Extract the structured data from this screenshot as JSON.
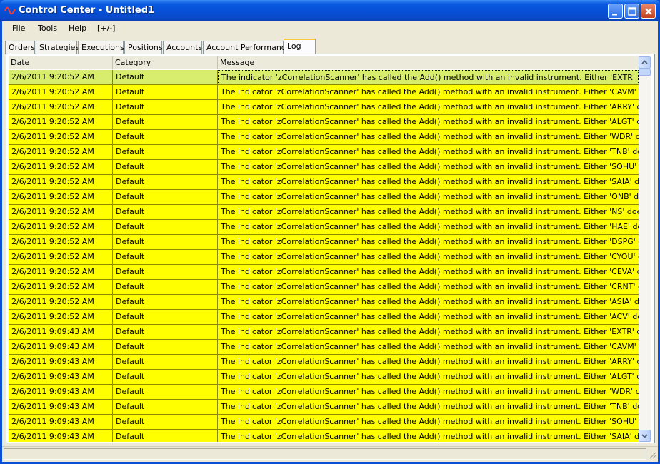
{
  "window": {
    "title": "Control Center - Untitled1"
  },
  "menu": {
    "items": [
      "File",
      "Tools",
      "Help",
      "[+/-]"
    ]
  },
  "tabs": [
    "Orders",
    "Strategies",
    "Executions",
    "Positions",
    "Accounts",
    "Account Performance",
    "Log"
  ],
  "active_tab": "Log",
  "grid": {
    "columns": [
      "Date",
      "Category",
      "Message"
    ],
    "rows": [
      {
        "date": "2/6/2011 9:20:52 AM",
        "category": "Default",
        "message": "The indicator 'zCorrelationScanner' has called the Add() method with an invalid instrument. Either 'EXTR' does not"
      },
      {
        "date": "2/6/2011 9:20:52 AM",
        "category": "Default",
        "message": "The indicator 'zCorrelationScanner' has called the Add() method with an invalid instrument. Either 'CAVM' does not"
      },
      {
        "date": "2/6/2011 9:20:52 AM",
        "category": "Default",
        "message": "The indicator 'zCorrelationScanner' has called the Add() method with an invalid instrument. Either 'ARRY' does not"
      },
      {
        "date": "2/6/2011 9:20:52 AM",
        "category": "Default",
        "message": "The indicator 'zCorrelationScanner' has called the Add() method with an invalid instrument. Either 'ALGT' does not e"
      },
      {
        "date": "2/6/2011 9:20:52 AM",
        "category": "Default",
        "message": "The indicator 'zCorrelationScanner' has called the Add() method with an invalid instrument. Either 'WDR' does not e"
      },
      {
        "date": "2/6/2011 9:20:52 AM",
        "category": "Default",
        "message": "The indicator 'zCorrelationScanner' has called the Add() method with an invalid instrument. Either 'TNB' does not ex"
      },
      {
        "date": "2/6/2011 9:20:52 AM",
        "category": "Default",
        "message": "The indicator 'zCorrelationScanner' has called the Add() method with an invalid instrument. Either 'SOHU' does not"
      },
      {
        "date": "2/6/2011 9:20:52 AM",
        "category": "Default",
        "message": "The indicator 'zCorrelationScanner' has called the Add() method with an invalid instrument. Either 'SAIA' does not e"
      },
      {
        "date": "2/6/2011 9:20:52 AM",
        "category": "Default",
        "message": "The indicator 'zCorrelationScanner' has called the Add() method with an invalid instrument. Either 'ONB' does not e"
      },
      {
        "date": "2/6/2011 9:20:52 AM",
        "category": "Default",
        "message": "The indicator 'zCorrelationScanner' has called the Add() method with an invalid instrument. Either 'NS' does not exis"
      },
      {
        "date": "2/6/2011 9:20:52 AM",
        "category": "Default",
        "message": "The indicator 'zCorrelationScanner' has called the Add() method with an invalid instrument. Either 'HAE' does not ex"
      },
      {
        "date": "2/6/2011 9:20:52 AM",
        "category": "Default",
        "message": "The indicator 'zCorrelationScanner' has called the Add() method with an invalid instrument. Either 'DSPG' does not"
      },
      {
        "date": "2/6/2011 9:20:52 AM",
        "category": "Default",
        "message": "The indicator 'zCorrelationScanner' has called the Add() method with an invalid instrument. Either 'CYOU' does not"
      },
      {
        "date": "2/6/2011 9:20:52 AM",
        "category": "Default",
        "message": "The indicator 'zCorrelationScanner' has called the Add() method with an invalid instrument. Either 'CEVA' does not"
      },
      {
        "date": "2/6/2011 9:20:52 AM",
        "category": "Default",
        "message": "The indicator 'zCorrelationScanner' has called the Add() method with an invalid instrument. Either 'CRNT' does not"
      },
      {
        "date": "2/6/2011 9:20:52 AM",
        "category": "Default",
        "message": "The indicator 'zCorrelationScanner' has called the Add() method with an invalid instrument. Either 'ASIA' does not e"
      },
      {
        "date": "2/6/2011 9:20:52 AM",
        "category": "Default",
        "message": "The indicator 'zCorrelationScanner' has called the Add() method with an invalid instrument. Either 'ACV' does not ex"
      },
      {
        "date": "2/6/2011 9:09:43 AM",
        "category": "Default",
        "message": "The indicator 'zCorrelationScanner' has called the Add() method with an invalid instrument. Either 'EXTR' does not"
      },
      {
        "date": "2/6/2011 9:09:43 AM",
        "category": "Default",
        "message": "The indicator 'zCorrelationScanner' has called the Add() method with an invalid instrument. Either 'CAVM' does not"
      },
      {
        "date": "2/6/2011 9:09:43 AM",
        "category": "Default",
        "message": "The indicator 'zCorrelationScanner' has called the Add() method with an invalid instrument. Either 'ARRY' does not"
      },
      {
        "date": "2/6/2011 9:09:43 AM",
        "category": "Default",
        "message": "The indicator 'zCorrelationScanner' has called the Add() method with an invalid instrument. Either 'ALGT' does not e"
      },
      {
        "date": "2/6/2011 9:09:43 AM",
        "category": "Default",
        "message": "The indicator 'zCorrelationScanner' has called the Add() method with an invalid instrument. Either 'WDR' does not e"
      },
      {
        "date": "2/6/2011 9:09:43 AM",
        "category": "Default",
        "message": "The indicator 'zCorrelationScanner' has called the Add() method with an invalid instrument. Either 'TNB' does not ex"
      },
      {
        "date": "2/6/2011 9:09:43 AM",
        "category": "Default",
        "message": "The indicator 'zCorrelationScanner' has called the Add() method with an invalid instrument. Either 'SOHU' does not"
      },
      {
        "date": "2/6/2011 9:09:43 AM",
        "category": "Default",
        "message": "The indicator 'zCorrelationScanner' has called the Add() method with an invalid instrument. Either 'SAIA' does not e"
      }
    ]
  },
  "colors": {
    "row_background": "#ffff00",
    "selected_row_background": "#d8ed6e",
    "title_bar": "#0650d8"
  },
  "icons": {
    "app": "sine-wave-icon",
    "minimize": "minimize-icon",
    "maximize": "maximize-icon",
    "close": "close-icon"
  }
}
